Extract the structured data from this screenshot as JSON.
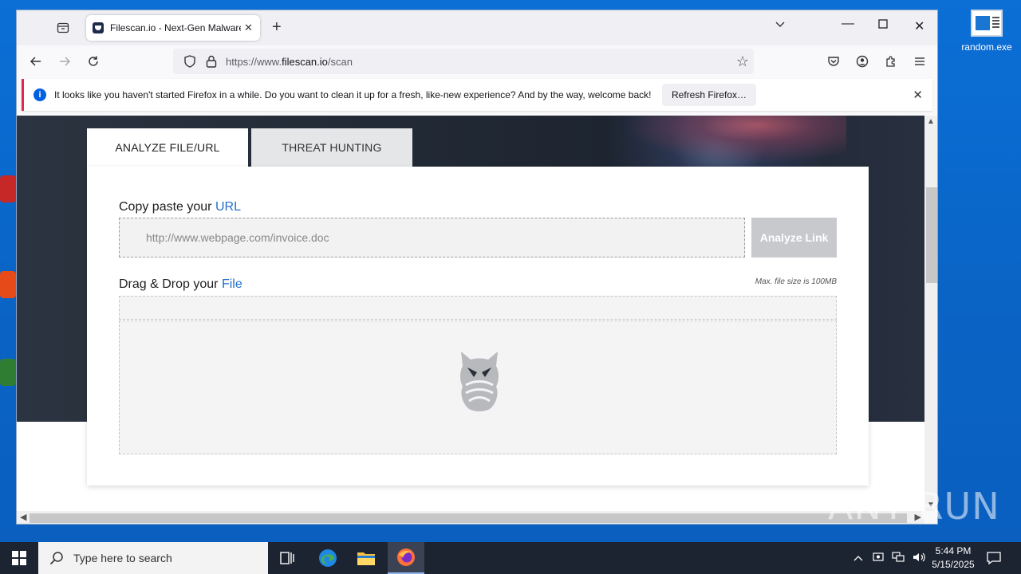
{
  "desktop": {
    "file_icon_label": "random.exe"
  },
  "browser": {
    "tab": {
      "title": "Filescan.io - Next-Gen Malware"
    },
    "url": {
      "prefix": "https://www.",
      "host": "filescan.io",
      "path": "/scan"
    },
    "notification": {
      "message": "It looks like you haven't started Firefox in a while. Do you want to clean it up for a fresh, like-new experience? And by the way, welcome back!",
      "button": "Refresh Firefox…"
    }
  },
  "page": {
    "tabs": [
      {
        "label": "ANALYZE FILE/URL",
        "active": true
      },
      {
        "label": "THREAT HUNTING",
        "active": false
      }
    ],
    "url_section": {
      "label_prefix": "Copy paste your ",
      "label_highlight": "URL",
      "placeholder": "http://www.webpage.com/invoice.doc",
      "button": "Analyze Link"
    },
    "file_section": {
      "label_prefix": "Drag & Drop your ",
      "label_highlight": "File",
      "max_size": "Max. file size is 100MB"
    }
  },
  "watermark": "ANY RUN",
  "taskbar": {
    "search_placeholder": "Type here to search",
    "time": "5:44 PM",
    "date": "5/15/2025"
  },
  "colors": {
    "accent": "#1f6fce",
    "desktop": "#0b6fd6",
    "taskbar": "#1c2331",
    "notification_border": "#e22850",
    "chat": "#1a73e8"
  }
}
